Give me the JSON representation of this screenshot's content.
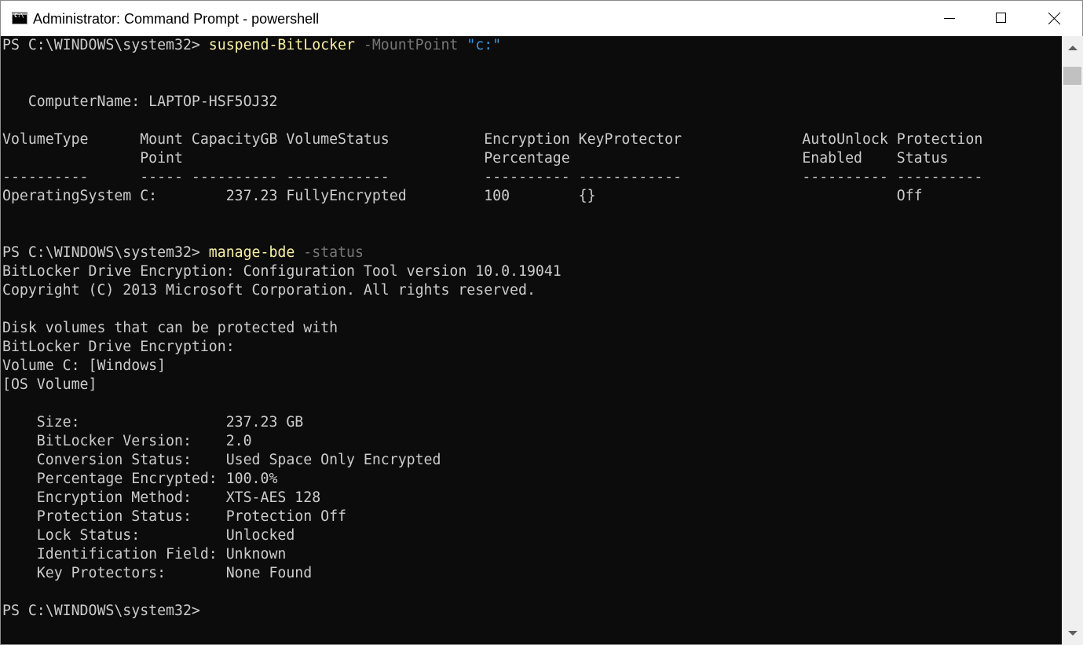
{
  "window": {
    "title": "Administrator: Command Prompt - powershell",
    "icon": "cmd-console-icon",
    "icon_text": "C:\\",
    "caption_buttons": [
      "minimize-icon",
      "maximize-icon",
      "close-icon"
    ]
  },
  "colors": {
    "background": "#0c0c0c",
    "text": "#cccccc",
    "command": "#f9f1a5",
    "parameter": "#767676",
    "string": "#3a96dd"
  },
  "console": {
    "prompt1": "PS C:\\WINDOWS\\system32> ",
    "cmd1_name": "suspend-BitLocker",
    "cmd1_param": " -MountPoint ",
    "cmd1_value": "\"c:\"",
    "computer_name": "   ComputerName: LAPTOP-HSF5OJ32",
    "table_header_1": "VolumeType      Mount CapacityGB VolumeStatus           Encryption KeyProtector              AutoUnlock Protection",
    "table_header_2": "                Point                                   Percentage                           Enabled    Status",
    "table_rule": "----------      ----- ---------- ------------           ---------- ------------              ---------- ----------",
    "table_row": "OperatingSystem C:        237.23 FullyEncrypted         100        {}                                   Off",
    "prompt2": "PS C:\\WINDOWS\\system32> ",
    "cmd2_name": "manage-bde",
    "cmd2_param": " -status",
    "tool_line": "BitLocker Drive Encryption: Configuration Tool version 10.0.19041",
    "copyright_line": "Copyright (C) 2013 Microsoft Corporation. All rights reserved.",
    "disk_line_1": "Disk volumes that can be protected with",
    "disk_line_2": "BitLocker Drive Encryption:",
    "volume_line": "Volume C: [Windows]",
    "os_volume_line": "[OS Volume]",
    "status": [
      "    Size:                 237.23 GB",
      "    BitLocker Version:    2.0",
      "    Conversion Status:    Used Space Only Encrypted",
      "    Percentage Encrypted: 100.0%",
      "    Encryption Method:    XTS-AES 128",
      "    Protection Status:    Protection Off",
      "    Lock Status:          Unlocked",
      "    Identification Field: Unknown",
      "    Key Protectors:       None Found"
    ],
    "prompt3": "PS C:\\WINDOWS\\system32>"
  }
}
